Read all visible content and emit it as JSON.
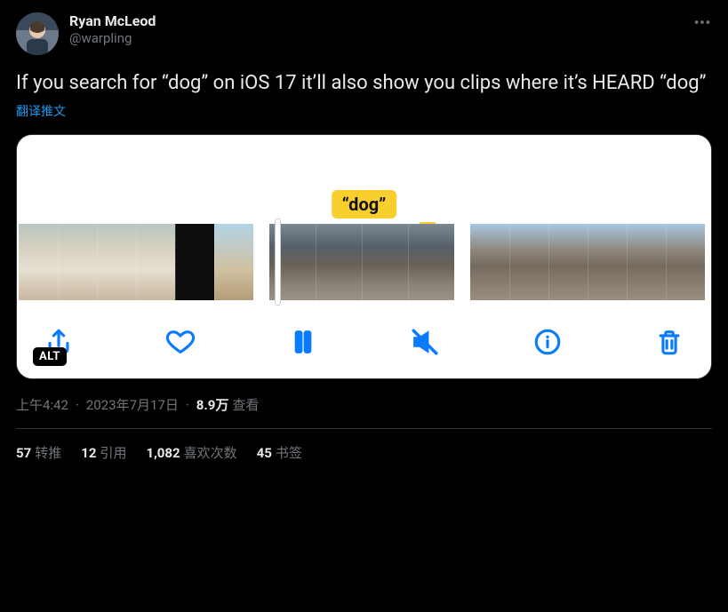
{
  "user": {
    "display_name": "Ryan McLeod",
    "handle": "@warpling"
  },
  "tweet": {
    "text": "If you search for “dog” on iOS 17 it’ll also show you clips where it’s HEARD “dog”",
    "translate_label": "翻译推文"
  },
  "media": {
    "tag_label": "“dog”",
    "alt_badge": "ALT",
    "toolbar_icons": {
      "share": "share-icon",
      "heart": "heart-icon",
      "pause": "pause-icon",
      "mute": "speaker-muted-icon",
      "info": "info-icon",
      "trash": "trash-icon"
    }
  },
  "meta": {
    "time": "上午4:42",
    "date": "2023年7月17日",
    "views_count": "8.9万",
    "views_label": "查看"
  },
  "stats": {
    "retweets": {
      "count": "57",
      "label": "转推"
    },
    "quotes": {
      "count": "12",
      "label": "引用"
    },
    "likes": {
      "count": "1,082",
      "label": "喜欢次数"
    },
    "bookmarks": {
      "count": "45",
      "label": "书签"
    }
  }
}
